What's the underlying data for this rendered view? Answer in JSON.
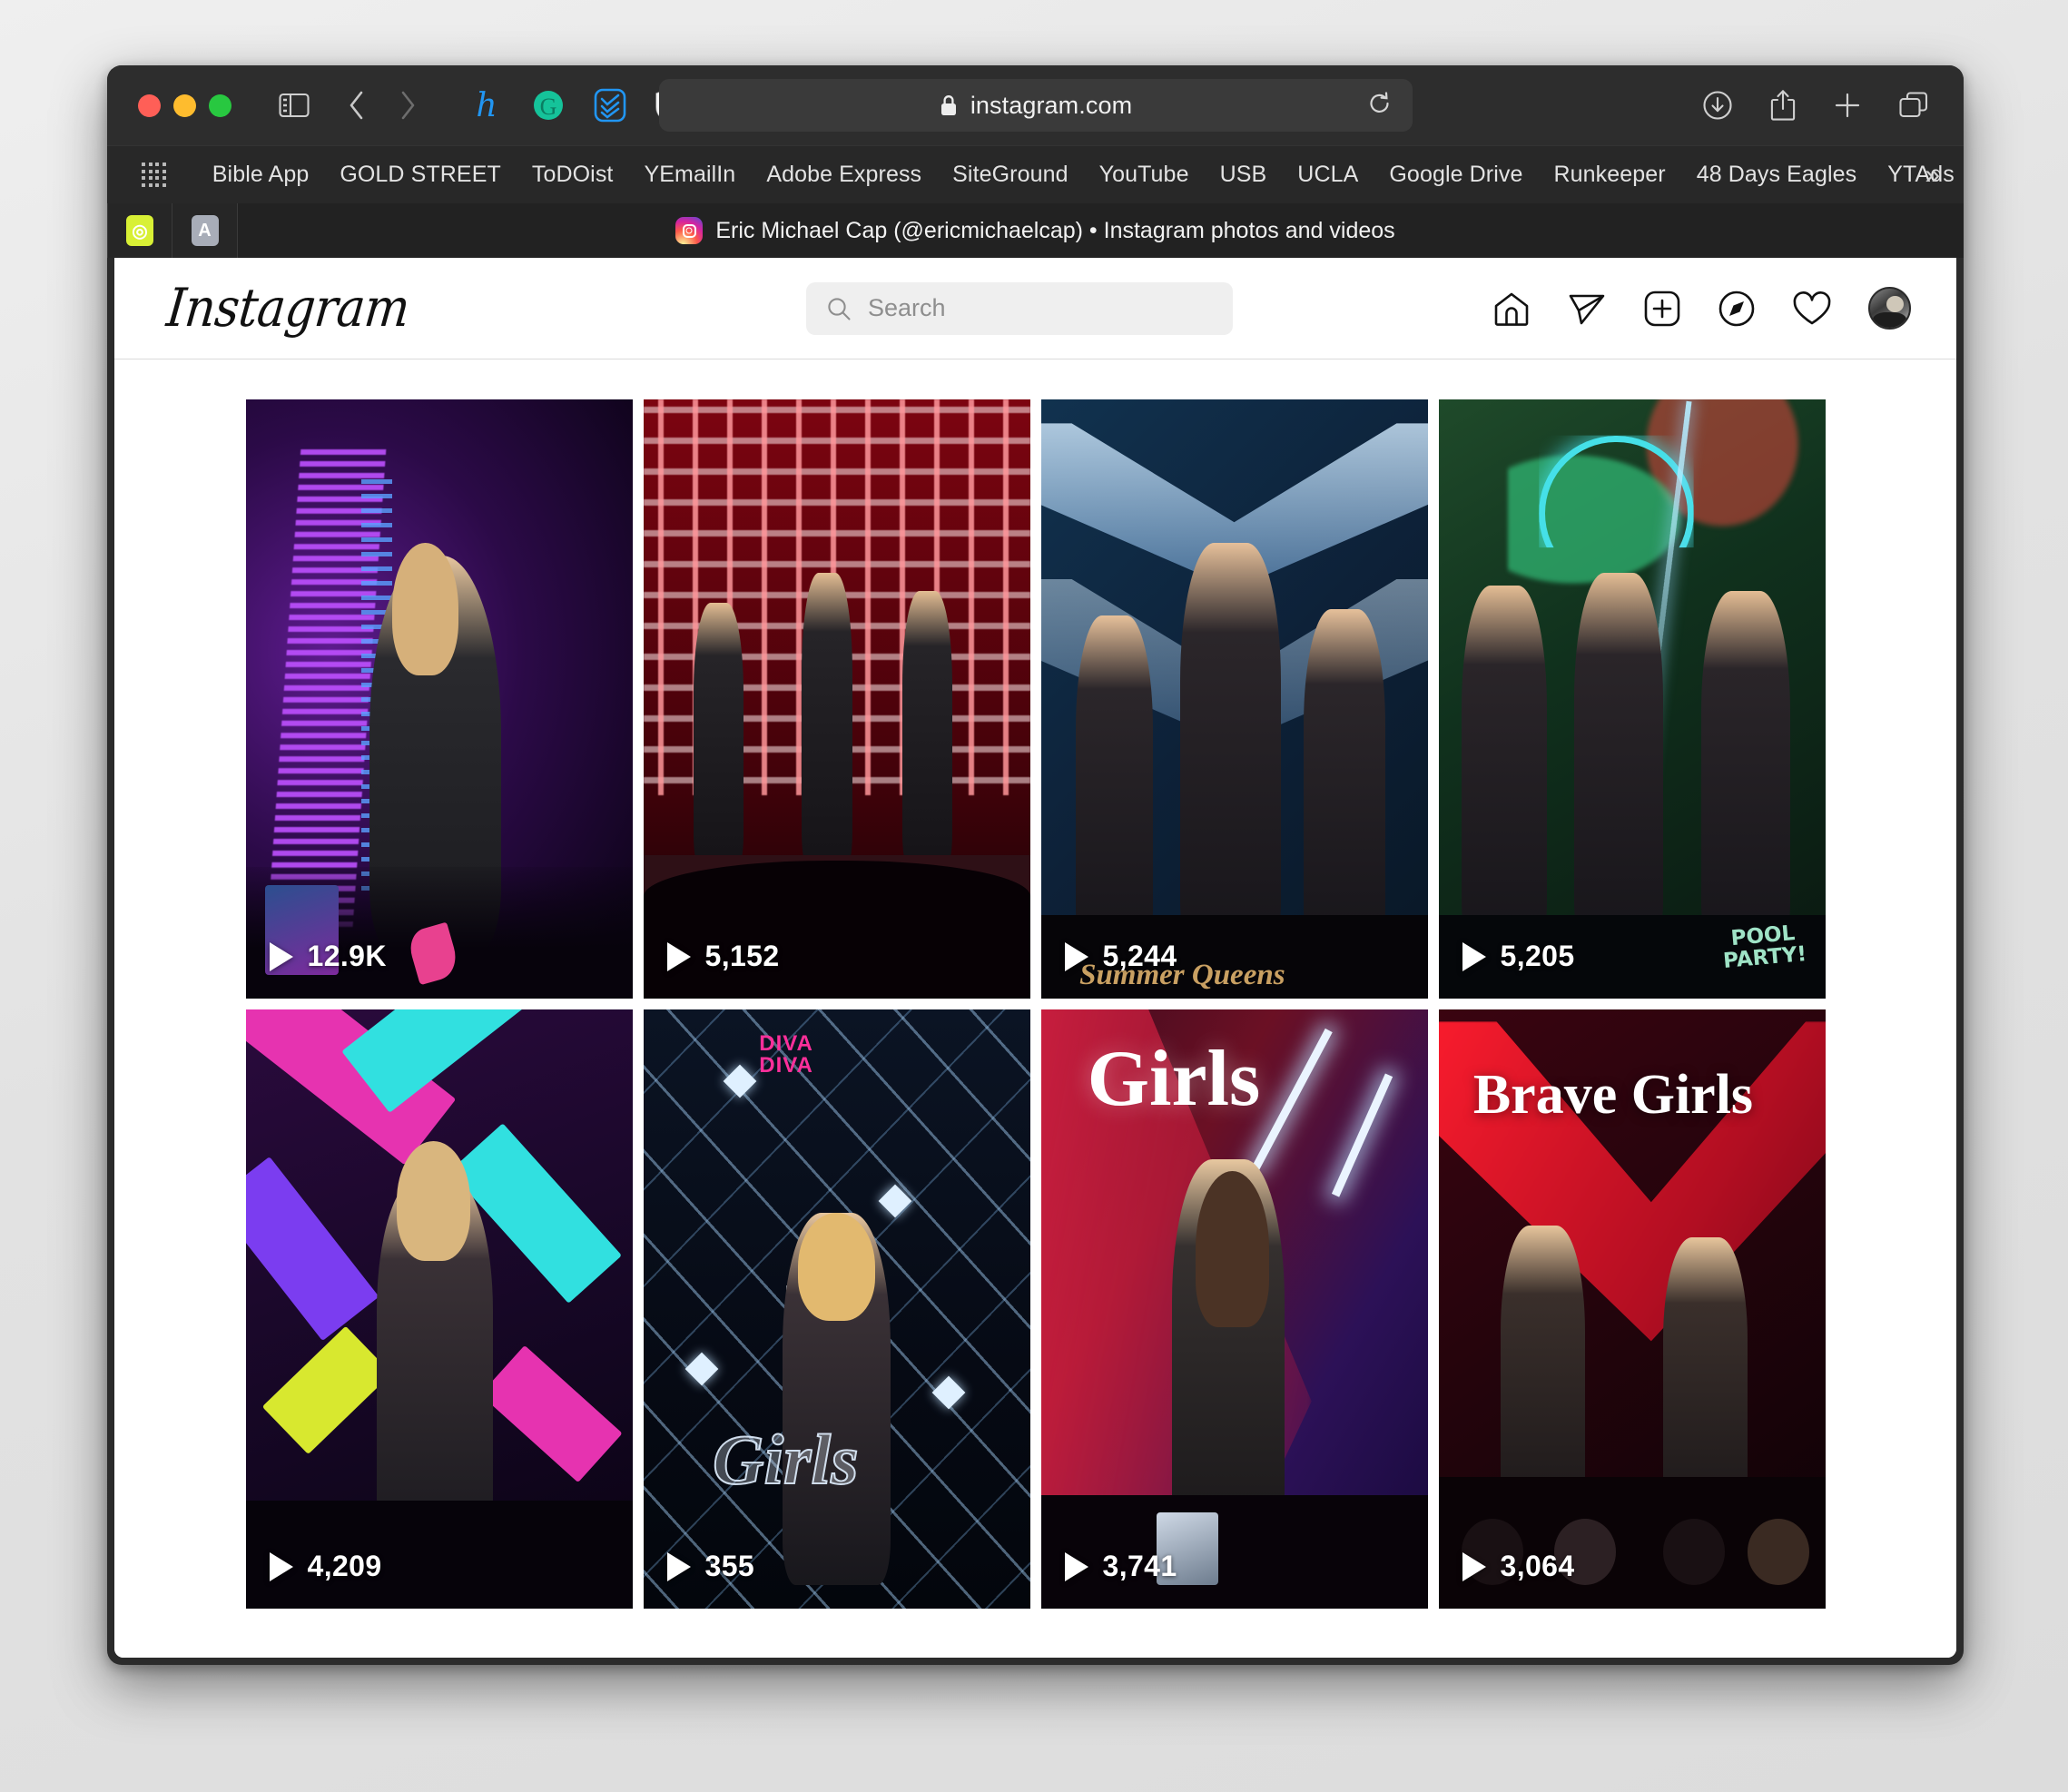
{
  "browser": {
    "url": "instagram.com",
    "lock_icon": "lock-icon",
    "reload_icon": "reload-icon",
    "traffic_lights": [
      "close",
      "minimize",
      "maximize"
    ],
    "toolbar_icons": [
      "sidebar-toggle-icon",
      "back-arrow-icon",
      "forward-arrow-icon",
      "honey-extension-icon",
      "grammarly-extension-icon",
      "todoist-extension-icon",
      "shield-extension-icon"
    ],
    "right_tools": [
      "downloads-icon",
      "share-icon",
      "new-tab-icon",
      "tab-overview-icon"
    ],
    "bookmarks": [
      "Bible App",
      "GOLD STREET",
      "ToDOist",
      "YEmailIn",
      "Adobe Express",
      "SiteGround",
      "YouTube",
      "USB",
      "UCLA",
      "Google Drive",
      "Runkeeper",
      "48 Days Eagles",
      "YTAds"
    ],
    "bookmarks_overflow": "»",
    "apps_grid_icon": "apps-grid-icon",
    "mini_tabs": [
      {
        "favicon_label": "◎",
        "name": "tab-pinned-1"
      },
      {
        "favicon_label": "A",
        "name": "tab-pinned-2"
      }
    ],
    "active_tab_title": "Eric Michael Cap (@ericmichaelcap) • Instagram photos and videos"
  },
  "instagram": {
    "logo": "Instagram",
    "search": {
      "placeholder": "Search",
      "value": "",
      "icon": "search-icon"
    },
    "nav": [
      {
        "name": "home-icon",
        "label": "Home"
      },
      {
        "name": "messenger-icon",
        "label": "Messages"
      },
      {
        "name": "new-post-icon",
        "label": "New post"
      },
      {
        "name": "explore-icon",
        "label": "Explore"
      },
      {
        "name": "activity-heart-icon",
        "label": "Notifications"
      },
      {
        "name": "profile-avatar",
        "label": "Profile"
      }
    ],
    "grid": [
      {
        "views": "12.9K",
        "play_icon": "play-icon",
        "overlay_text": "",
        "alt": "Performer in black dress on stage with purple equalizer backdrop"
      },
      {
        "views": "5,152",
        "play_icon": "play-icon",
        "overlay_text": "",
        "alt": "Three performers on stage with red LED curtain backdrop"
      },
      {
        "views": "5,244",
        "play_icon": "play-icon",
        "overlay_text": "Summer Queens",
        "alt": "Three performers with chevron LED screen backdrop"
      },
      {
        "views": "5,205",
        "play_icon": "play-icon",
        "overlay_text": "POOL\nPARTY!",
        "alt": "Three performers with neon palm tree backdrop"
      },
      {
        "views": "4,209",
        "play_icon": "play-icon",
        "overlay_text": "",
        "alt": "Performer with magenta and cyan chevron stage lighting"
      },
      {
        "views": "355",
        "play_icon": "play-icon",
        "overlay_text": "Girls",
        "secondary_overlay_text": "DIVA\nDIVA",
        "alt": "Performer at microphone with Girls LED backdrop"
      },
      {
        "views": "3,741",
        "play_icon": "play-icon",
        "overlay_text": "Girls",
        "alt": "Performer with red and blue Girls backdrop"
      },
      {
        "views": "3,064",
        "play_icon": "play-icon",
        "overlay_text": "Brave Girls",
        "alt": "Two performers with red chevron Brave Girls backdrop"
      }
    ]
  },
  "colors": {
    "browser_chrome": "#2d2d2d",
    "bookmarks_bar": "#282828",
    "tab_bar": "#222222",
    "page_bg": "#ffffff",
    "ig_border": "#dbdbdb",
    "search_bg": "#efefef",
    "placeholder": "#8e8e8e",
    "traffic_red": "#ff5f57",
    "traffic_yellow": "#febc2e",
    "traffic_green": "#28c840"
  }
}
